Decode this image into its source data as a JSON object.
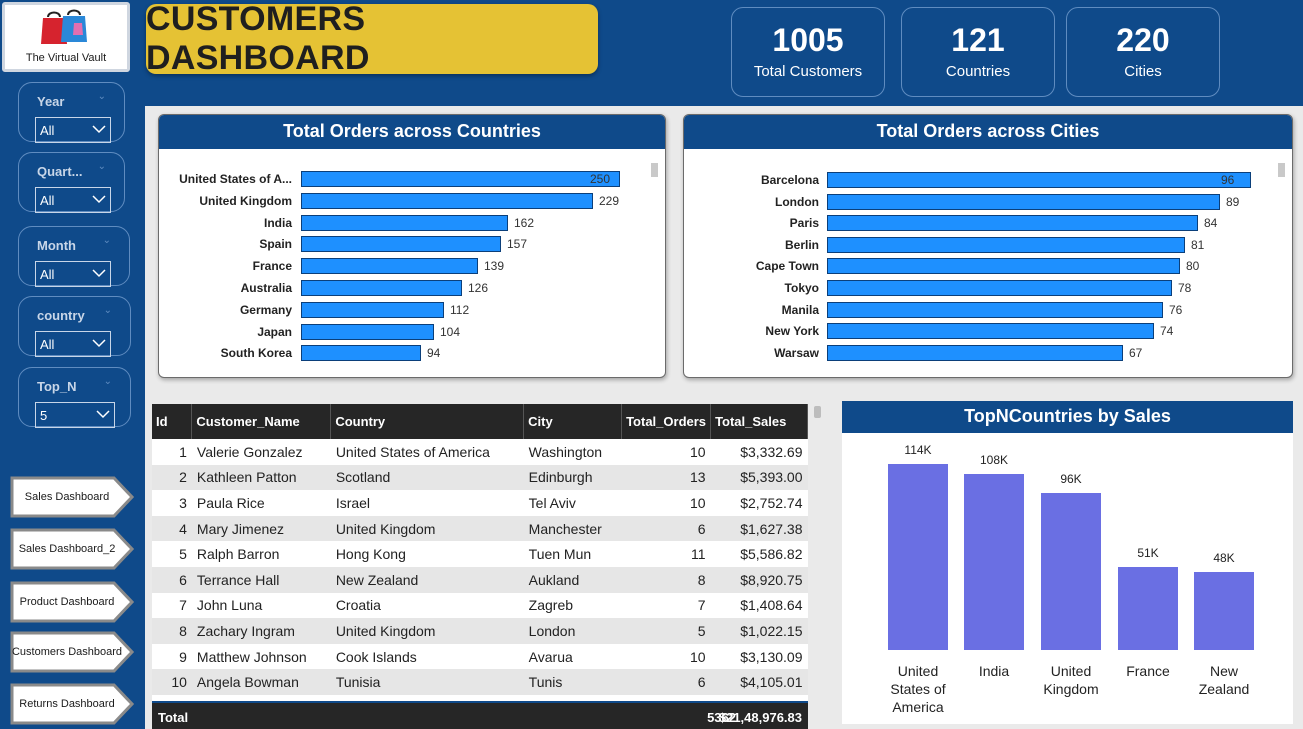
{
  "logo": {
    "text": "The Virtual Vault",
    "icon": "shopping-bags-icon"
  },
  "title": "CUSTOMERS DASHBOARD",
  "kpis": [
    {
      "value": "1005",
      "label": "Total Customers"
    },
    {
      "value": "121",
      "label": "Countries"
    },
    {
      "value": "220",
      "label": "Cities"
    }
  ],
  "slicers": [
    {
      "label": "Year",
      "value": "All"
    },
    {
      "label": "Quart...",
      "value": "All"
    },
    {
      "label": "Month",
      "value": "All"
    },
    {
      "label": "country",
      "value": "All"
    },
    {
      "label": "Top_N",
      "value": "5"
    }
  ],
  "nav": [
    "Sales Dashboard",
    "Sales Dashboard_2",
    "Product Dashboard",
    "Customers Dashboard",
    "Returns Dashboard"
  ],
  "chart_data": [
    {
      "type": "bar",
      "orientation": "horizontal",
      "title": "Total Orders across Countries",
      "categories": [
        "United States of A...",
        "United Kingdom",
        "India",
        "Spain",
        "France",
        "Australia",
        "Germany",
        "Japan",
        "South Korea"
      ],
      "values": [
        250,
        229,
        162,
        157,
        139,
        126,
        112,
        104,
        94
      ],
      "bar_color": "#1e90ff"
    },
    {
      "type": "bar",
      "orientation": "horizontal",
      "title": "Total Orders across Cities",
      "categories": [
        "Barcelona",
        "London",
        "Paris",
        "Berlin",
        "Cape Town",
        "Tokyo",
        "Manila",
        "New York",
        "Warsaw"
      ],
      "values": [
        96,
        89,
        84,
        81,
        80,
        78,
        76,
        74,
        67
      ],
      "bar_color": "#1e90ff"
    },
    {
      "type": "bar",
      "orientation": "vertical",
      "title": "TopNCountries by Sales",
      "categories": [
        "United States of America",
        "India",
        "United Kingdom",
        "France",
        "New Zealand"
      ],
      "values": [
        114000,
        108000,
        96000,
        51000,
        48000
      ],
      "labels": [
        "114K",
        "108K",
        "96K",
        "51K",
        "48K"
      ],
      "bar_color": "#6a6fe3"
    }
  ],
  "table": {
    "columns": [
      "Id",
      "Customer_Name",
      "Country",
      "City",
      "Total_Orders",
      "Total_Sales"
    ],
    "rows": [
      [
        "1",
        "Valerie Gonzalez",
        "United States of America",
        "Washington",
        "10",
        "$3,332.69"
      ],
      [
        "2",
        "Kathleen Patton",
        "Scotland",
        "Edinburgh",
        "13",
        "$5,393.00"
      ],
      [
        "3",
        "Paula Rice",
        "Israel",
        "Tel Aviv",
        "10",
        "$2,752.74"
      ],
      [
        "4",
        "Mary Jimenez",
        "United Kingdom",
        "Manchester",
        "6",
        "$1,627.38"
      ],
      [
        "5",
        "Ralph Barron",
        "Hong Kong",
        "Tuen Mun",
        "11",
        "$5,586.82"
      ],
      [
        "6",
        "Terrance Hall",
        "New Zealand",
        "Aukland",
        "8",
        "$8,920.75"
      ],
      [
        "7",
        "John Luna",
        "Croatia",
        "Zagreb",
        "7",
        "$1,408.64"
      ],
      [
        "8",
        "Zachary Ingram",
        "United Kingdom",
        "London",
        "5",
        "$1,022.15"
      ],
      [
        "9",
        "Matthew Johnson",
        "Cook Islands",
        "Avarua",
        "10",
        "$3,130.09"
      ],
      [
        "10",
        "Angela Bowman",
        "Tunisia",
        "Tunis",
        "6",
        "$4,105.01"
      ]
    ],
    "total": {
      "label": "Total",
      "orders": "5362",
      "sales": "$21,48,976.83"
    }
  },
  "colors": {
    "background": "#0f4a8a",
    "title_bg": "#e5c234",
    "hbar": "#1e90ff",
    "vbar": "#6a6fe3"
  }
}
